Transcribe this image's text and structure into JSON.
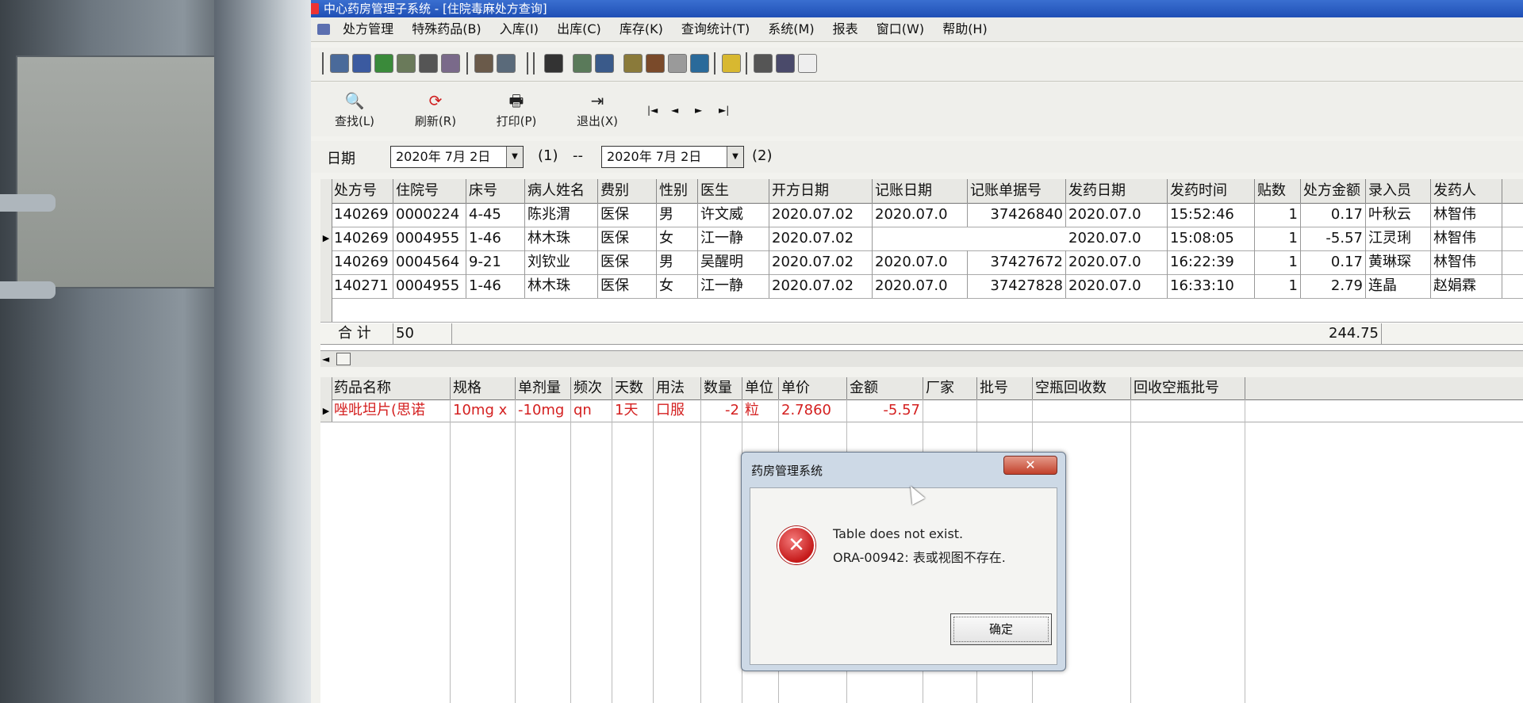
{
  "window": {
    "title": "中心药房管理子系统 - [住院毒麻处方查询]"
  },
  "menu": [
    "处方管理",
    "特殊药品(B)",
    "入库(I)",
    "出库(C)",
    "库存(K)",
    "查询统计(T)",
    "系统(M)",
    "报表",
    "窗口(W)",
    "帮助(H)"
  ],
  "actions": {
    "find": "查找(L)",
    "refresh": "刷新(R)",
    "print": "打印(P)",
    "exit": "退出(X)"
  },
  "nav": {
    "first": "|◄",
    "prev": "◄",
    "next": "►",
    "last": "►|"
  },
  "filter": {
    "label": "日期",
    "from": "2020年 7月 2日",
    "from_hint": "(1)",
    "sep": "--",
    "to": "2020年 7月 2日",
    "to_hint": "(2)"
  },
  "prescriptions": {
    "columns": [
      "处方号",
      "住院号",
      "床号",
      "病人姓名",
      "费别",
      "性别",
      "医生",
      "开方日期",
      "记账日期",
      "记账单据号",
      "发药日期",
      "发药时间",
      "贴数",
      "处方金额",
      "录入员",
      "发药人"
    ],
    "rows": [
      [
        "140269",
        "0000224",
        "4-45",
        "陈兆渭",
        "医保",
        "男",
        "许文威",
        "2020.07.02",
        "2020.07.0",
        "37426840",
        "2020.07.0",
        "15:52:46",
        "1",
        "0.17",
        "叶秋云",
        "林智伟"
      ],
      [
        "140269",
        "0004955",
        "1-46",
        "林木珠",
        "医保",
        "女",
        "江一静",
        "2020.07.02",
        "",
        "",
        "2020.07.0",
        "15:08:05",
        "1",
        "-5.57",
        "江灵琍",
        "林智伟"
      ],
      [
        "140269",
        "0004564",
        "9-21",
        "刘钦业",
        "医保",
        "男",
        "吴醒明",
        "2020.07.02",
        "2020.07.0",
        "37427672",
        "2020.07.0",
        "16:22:39",
        "1",
        "0.17",
        "黄琳琛",
        "林智伟"
      ],
      [
        "140271",
        "0004955",
        "1-46",
        "林木珠",
        "医保",
        "女",
        "江一静",
        "2020.07.02",
        "2020.07.0",
        "37427828",
        "2020.07.0",
        "16:33:10",
        "1",
        "2.79",
        "连晶",
        "赵娟霖"
      ]
    ],
    "totals": {
      "label": "合  计",
      "count": "50",
      "amount": "244.75"
    }
  },
  "drugs": {
    "columns": [
      "药品名称",
      "规格",
      "单剂量",
      "频次",
      "天数",
      "用法",
      "数量",
      "单位",
      "单价",
      "金额",
      "厂家",
      "批号",
      "空瓶回收数",
      "回收空瓶批号"
    ],
    "rows": [
      [
        "唑吡坦片(思诺",
        "10mg x",
        "-10mg",
        "qn",
        "1天",
        "口服",
        "-2",
        "粒",
        "2.7860",
        "-5.57",
        "",
        "",
        "",
        ""
      ]
    ]
  },
  "dialog": {
    "title": "药房管理系统",
    "close": "✕",
    "message_line1": "Table does not exist.",
    "message_line2": "ORA-00942: 表或视图不存在.",
    "ok": "确定"
  },
  "colors": {
    "title_bar": "#2a5cc4",
    "error_red": "#c51a1a",
    "drug_text": "#d42020"
  }
}
